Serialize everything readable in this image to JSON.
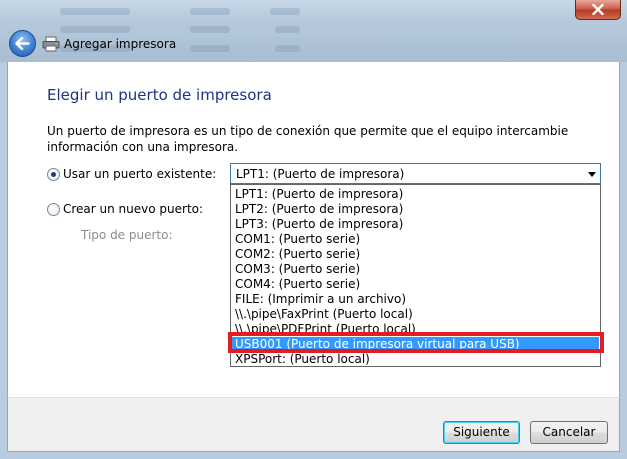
{
  "window": {
    "title": "Agregar impresora",
    "close_icon": "close-icon",
    "back_icon": "back-arrow-icon",
    "app_icon": "printer-icon"
  },
  "page": {
    "heading": "Elegir un puerto de impresora",
    "description": "Un puerto de impresora es un tipo de conexión que permite que el equipo intercambie información con una impresora."
  },
  "options": {
    "existing_label": "Usar un puerto existente:",
    "new_label": "Crear un nuevo puerto:",
    "port_type_label": "Tipo de puerto:"
  },
  "combo": {
    "selected": "LPT1: (Puerto de impresora)"
  },
  "dropdown": {
    "items": [
      "LPT1: (Puerto de impresora)",
      "LPT2: (Puerto de impresora)",
      "LPT3: (Puerto de impresora)",
      "COM1: (Puerto serie)",
      "COM2: (Puerto serie)",
      "COM3: (Puerto serie)",
      "COM4: (Puerto serie)",
      "FILE: (Imprimir a un archivo)",
      "\\\\.\\pipe\\FaxPrint (Puerto local)",
      "\\\\.\\pipe\\PDFPrint (Puerto local)",
      "USB001 (Puerto de impresora virtual para USB)",
      "XPSPort: (Puerto local)"
    ],
    "highlighted_index": 10
  },
  "buttons": {
    "next": "Siguiente",
    "cancel": "Cancelar"
  },
  "colors": {
    "heading": "#1e3287",
    "selection": "#3399ff",
    "annotation_border": "#e31b23"
  }
}
